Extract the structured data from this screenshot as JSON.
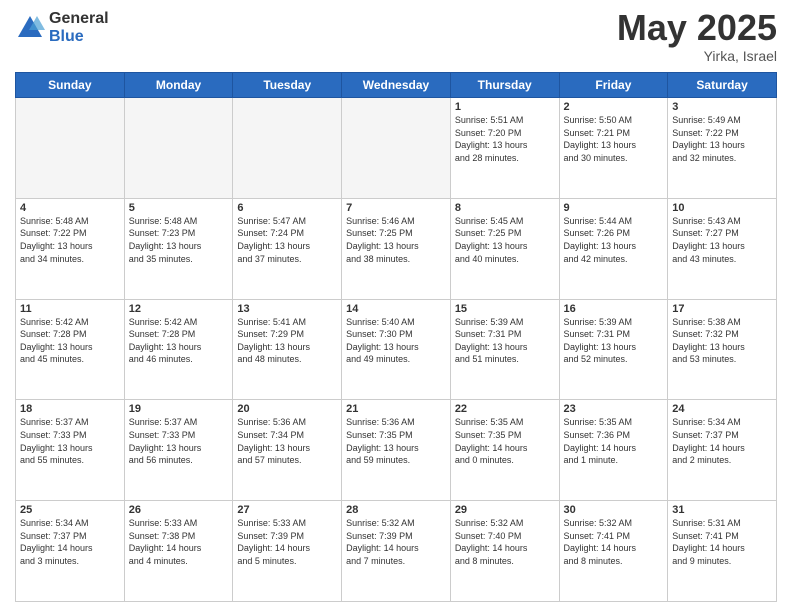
{
  "header": {
    "logo_general": "General",
    "logo_blue": "Blue",
    "month": "May 2025",
    "location": "Yirka, Israel"
  },
  "days_of_week": [
    "Sunday",
    "Monday",
    "Tuesday",
    "Wednesday",
    "Thursday",
    "Friday",
    "Saturday"
  ],
  "weeks": [
    [
      {
        "num": "",
        "info": "",
        "empty": true
      },
      {
        "num": "",
        "info": "",
        "empty": true
      },
      {
        "num": "",
        "info": "",
        "empty": true
      },
      {
        "num": "",
        "info": "",
        "empty": true
      },
      {
        "num": "1",
        "info": "Sunrise: 5:51 AM\nSunset: 7:20 PM\nDaylight: 13 hours\nand 28 minutes.",
        "empty": false
      },
      {
        "num": "2",
        "info": "Sunrise: 5:50 AM\nSunset: 7:21 PM\nDaylight: 13 hours\nand 30 minutes.",
        "empty": false
      },
      {
        "num": "3",
        "info": "Sunrise: 5:49 AM\nSunset: 7:22 PM\nDaylight: 13 hours\nand 32 minutes.",
        "empty": false
      }
    ],
    [
      {
        "num": "4",
        "info": "Sunrise: 5:48 AM\nSunset: 7:22 PM\nDaylight: 13 hours\nand 34 minutes.",
        "empty": false
      },
      {
        "num": "5",
        "info": "Sunrise: 5:48 AM\nSunset: 7:23 PM\nDaylight: 13 hours\nand 35 minutes.",
        "empty": false
      },
      {
        "num": "6",
        "info": "Sunrise: 5:47 AM\nSunset: 7:24 PM\nDaylight: 13 hours\nand 37 minutes.",
        "empty": false
      },
      {
        "num": "7",
        "info": "Sunrise: 5:46 AM\nSunset: 7:25 PM\nDaylight: 13 hours\nand 38 minutes.",
        "empty": false
      },
      {
        "num": "8",
        "info": "Sunrise: 5:45 AM\nSunset: 7:25 PM\nDaylight: 13 hours\nand 40 minutes.",
        "empty": false
      },
      {
        "num": "9",
        "info": "Sunrise: 5:44 AM\nSunset: 7:26 PM\nDaylight: 13 hours\nand 42 minutes.",
        "empty": false
      },
      {
        "num": "10",
        "info": "Sunrise: 5:43 AM\nSunset: 7:27 PM\nDaylight: 13 hours\nand 43 minutes.",
        "empty": false
      }
    ],
    [
      {
        "num": "11",
        "info": "Sunrise: 5:42 AM\nSunset: 7:28 PM\nDaylight: 13 hours\nand 45 minutes.",
        "empty": false
      },
      {
        "num": "12",
        "info": "Sunrise: 5:42 AM\nSunset: 7:28 PM\nDaylight: 13 hours\nand 46 minutes.",
        "empty": false
      },
      {
        "num": "13",
        "info": "Sunrise: 5:41 AM\nSunset: 7:29 PM\nDaylight: 13 hours\nand 48 minutes.",
        "empty": false
      },
      {
        "num": "14",
        "info": "Sunrise: 5:40 AM\nSunset: 7:30 PM\nDaylight: 13 hours\nand 49 minutes.",
        "empty": false
      },
      {
        "num": "15",
        "info": "Sunrise: 5:39 AM\nSunset: 7:31 PM\nDaylight: 13 hours\nand 51 minutes.",
        "empty": false
      },
      {
        "num": "16",
        "info": "Sunrise: 5:39 AM\nSunset: 7:31 PM\nDaylight: 13 hours\nand 52 minutes.",
        "empty": false
      },
      {
        "num": "17",
        "info": "Sunrise: 5:38 AM\nSunset: 7:32 PM\nDaylight: 13 hours\nand 53 minutes.",
        "empty": false
      }
    ],
    [
      {
        "num": "18",
        "info": "Sunrise: 5:37 AM\nSunset: 7:33 PM\nDaylight: 13 hours\nand 55 minutes.",
        "empty": false
      },
      {
        "num": "19",
        "info": "Sunrise: 5:37 AM\nSunset: 7:33 PM\nDaylight: 13 hours\nand 56 minutes.",
        "empty": false
      },
      {
        "num": "20",
        "info": "Sunrise: 5:36 AM\nSunset: 7:34 PM\nDaylight: 13 hours\nand 57 minutes.",
        "empty": false
      },
      {
        "num": "21",
        "info": "Sunrise: 5:36 AM\nSunset: 7:35 PM\nDaylight: 13 hours\nand 59 minutes.",
        "empty": false
      },
      {
        "num": "22",
        "info": "Sunrise: 5:35 AM\nSunset: 7:35 PM\nDaylight: 14 hours\nand 0 minutes.",
        "empty": false
      },
      {
        "num": "23",
        "info": "Sunrise: 5:35 AM\nSunset: 7:36 PM\nDaylight: 14 hours\nand 1 minute.",
        "empty": false
      },
      {
        "num": "24",
        "info": "Sunrise: 5:34 AM\nSunset: 7:37 PM\nDaylight: 14 hours\nand 2 minutes.",
        "empty": false
      }
    ],
    [
      {
        "num": "25",
        "info": "Sunrise: 5:34 AM\nSunset: 7:37 PM\nDaylight: 14 hours\nand 3 minutes.",
        "empty": false
      },
      {
        "num": "26",
        "info": "Sunrise: 5:33 AM\nSunset: 7:38 PM\nDaylight: 14 hours\nand 4 minutes.",
        "empty": false
      },
      {
        "num": "27",
        "info": "Sunrise: 5:33 AM\nSunset: 7:39 PM\nDaylight: 14 hours\nand 5 minutes.",
        "empty": false
      },
      {
        "num": "28",
        "info": "Sunrise: 5:32 AM\nSunset: 7:39 PM\nDaylight: 14 hours\nand 7 minutes.",
        "empty": false
      },
      {
        "num": "29",
        "info": "Sunrise: 5:32 AM\nSunset: 7:40 PM\nDaylight: 14 hours\nand 8 minutes.",
        "empty": false
      },
      {
        "num": "30",
        "info": "Sunrise: 5:32 AM\nSunset: 7:41 PM\nDaylight: 14 hours\nand 8 minutes.",
        "empty": false
      },
      {
        "num": "31",
        "info": "Sunrise: 5:31 AM\nSunset: 7:41 PM\nDaylight: 14 hours\nand 9 minutes.",
        "empty": false
      }
    ]
  ]
}
